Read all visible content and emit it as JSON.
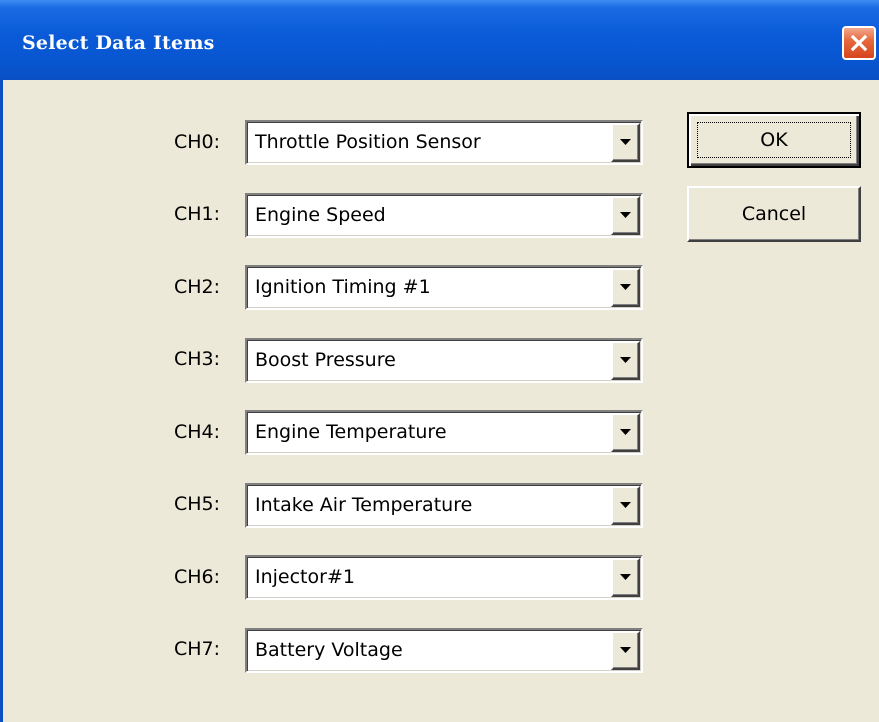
{
  "window": {
    "title": "Select Data Items"
  },
  "channels": [
    {
      "label": "CH0:",
      "value": "Throttle Position Sensor"
    },
    {
      "label": "CH1:",
      "value": "Engine Speed"
    },
    {
      "label": "CH2:",
      "value": "Ignition Timing #1"
    },
    {
      "label": "CH3:",
      "value": "Boost Pressure"
    },
    {
      "label": "CH4:",
      "value": "Engine Temperature"
    },
    {
      "label": "CH5:",
      "value": "Intake Air Temperature"
    },
    {
      "label": "CH6:",
      "value": "Injector#1"
    },
    {
      "label": "CH7:",
      "value": "Battery Voltage"
    }
  ],
  "buttons": {
    "ok_label": "OK",
    "cancel_label": "Cancel"
  },
  "icons": {
    "close": "close-icon",
    "dropdown": "chevron-down-icon"
  },
  "colors": {
    "titlebar": "#0a5ad8",
    "dialog_bg": "#ece9d8",
    "close_button": "#d6441c"
  }
}
